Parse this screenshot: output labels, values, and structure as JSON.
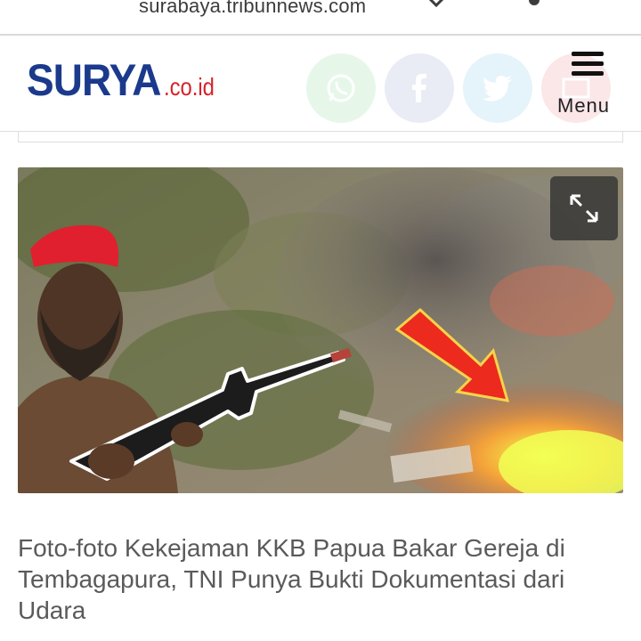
{
  "browser": {
    "url": "surabaya.tribunnews.com"
  },
  "header": {
    "logo_main": "SURYA",
    "logo_sub": ".co.id",
    "menu_label": "Menu",
    "share_icons": [
      "whatsapp-icon",
      "facebook-icon",
      "twitter-icon",
      "mail-icon"
    ]
  },
  "article": {
    "image_alt_icon": "expand-icon",
    "headline": "Foto-foto Kekejaman KKB Papua Bakar Gereja di Tembagapura, TNI Punya Bukti Dokumentasi dari Udara"
  },
  "colors": {
    "logo_blue": "#1b3a8c",
    "logo_red": "#d6232a",
    "headline_text": "#5a5a5a"
  }
}
